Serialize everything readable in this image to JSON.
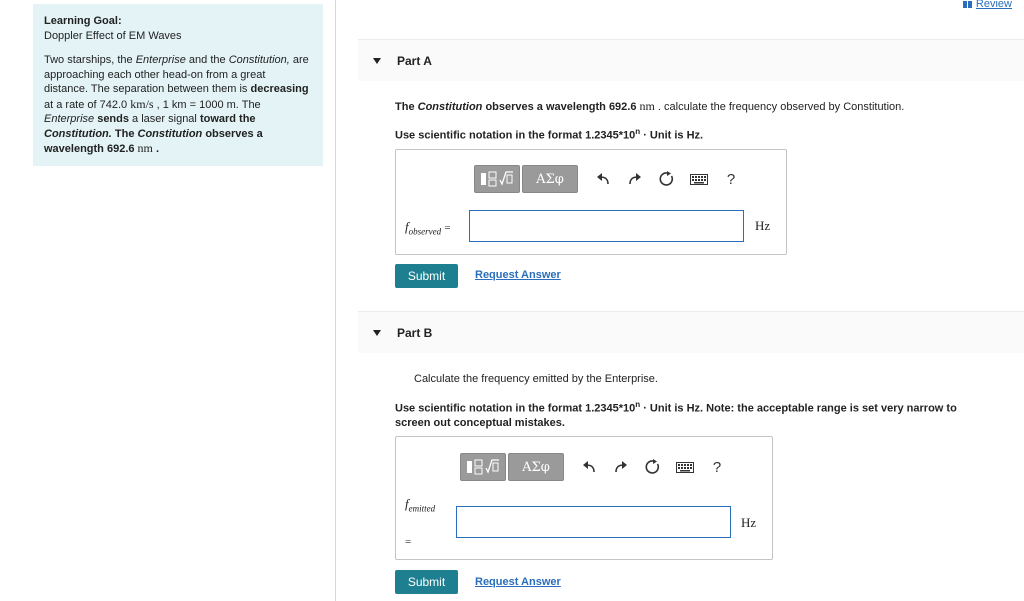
{
  "learning_goal": {
    "heading": "Learning Goal:",
    "topic": "Doppler Effect of EM Waves",
    "p1": "Two starships, the ",
    "enterprise": "Enterprise",
    "p2": " and the ",
    "constitution": "Constitution,",
    "p3": " are approaching each other head-on from a great distance. The separation between them is ",
    "decreasing": "decreasing",
    "p4": " at a rate of 742.0 ",
    "rate_unit": "km/s",
    "p5": " , 1 km = 1000 m. The ",
    "enterprise2": "Enterprise",
    "p6": " sends",
    "p7": " a laser signal ",
    "toward": "toward the",
    "constitution2": "Constitution.",
    "p8": " The ",
    "constitution3": "Constitution",
    "p9": " observes a wavelength 692.6 ",
    "wl_unit": "nm",
    "p10": " ."
  },
  "review": {
    "label": "Review"
  },
  "part_a": {
    "title": "Part A",
    "q1_a": "The ",
    "q1_b": "Constitution",
    "q1_c": " observes a wavelength 692.6 ",
    "q1_unit": "nm",
    "q1_d": " . calculate the frequency observed by Constitution.",
    "q2": "Use scientific notation in the format 1.2345*10",
    "q2_sup": "n",
    "q2_end": "· Unit is Hz.",
    "var_main": "f",
    "var_sub": "observed",
    "equals": "=",
    "unit": "Hz",
    "submit": "Submit",
    "request": "Request Answer"
  },
  "part_b": {
    "title": "Part B",
    "q1": "Calculate the frequency emitted by the Enterprise.",
    "q2": "Use scientific notation in the format 1.2345*10",
    "q2_sup": "n",
    "q2_end": "· Unit is Hz. Note: the acceptable range is set very narrow to",
    "q3": "screen out conceptual mistakes.",
    "var_main": "f",
    "var_sub": "emitted",
    "equals": "=",
    "unit": "Hz",
    "submit": "Submit",
    "request": "Request Answer"
  },
  "toolbar": {
    "greek": "ΑΣφ",
    "help": "?",
    "icons": [
      "templates-icon",
      "greek-symbols-icon",
      "undo-icon",
      "redo-icon",
      "reset-icon",
      "keyboard-icon",
      "help-icon"
    ]
  }
}
